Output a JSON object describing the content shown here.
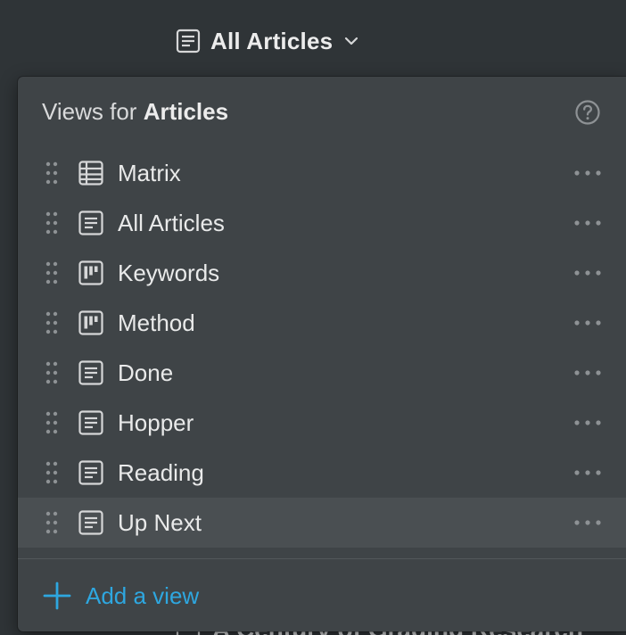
{
  "header": {
    "current_view": "All Articles",
    "current_view_icon": "list-view-icon",
    "dropdown_icon": "chevron-down-icon"
  },
  "popup": {
    "title_prefix": "Views for ",
    "title_database": "Articles",
    "help_icon": "help-circle-icon",
    "views": [
      {
        "label": "Matrix",
        "icon": "table-view-icon"
      },
      {
        "label": "All Articles",
        "icon": "list-view-icon"
      },
      {
        "label": "Keywords",
        "icon": "board-view-icon"
      },
      {
        "label": "Method",
        "icon": "board-view-icon"
      },
      {
        "label": "Done",
        "icon": "list-view-icon"
      },
      {
        "label": "Hopper",
        "icon": "list-view-icon"
      },
      {
        "label": "Reading",
        "icon": "list-view-icon"
      },
      {
        "label": "Up Next",
        "icon": "list-view-icon",
        "hovered": true
      }
    ],
    "add_view_label": "Add a view",
    "add_view_icon": "plus-icon"
  },
  "background": {
    "partial_row_text": "A Century of Grading Research"
  },
  "colors": {
    "page_bg": "#2f3437",
    "popup_bg": "#3f4447",
    "hover_bg": "#4a4f52",
    "text": "#e9eaea",
    "icon": "#d6d7d8",
    "muted": "#8e9295",
    "accent": "#2ea7e0"
  }
}
